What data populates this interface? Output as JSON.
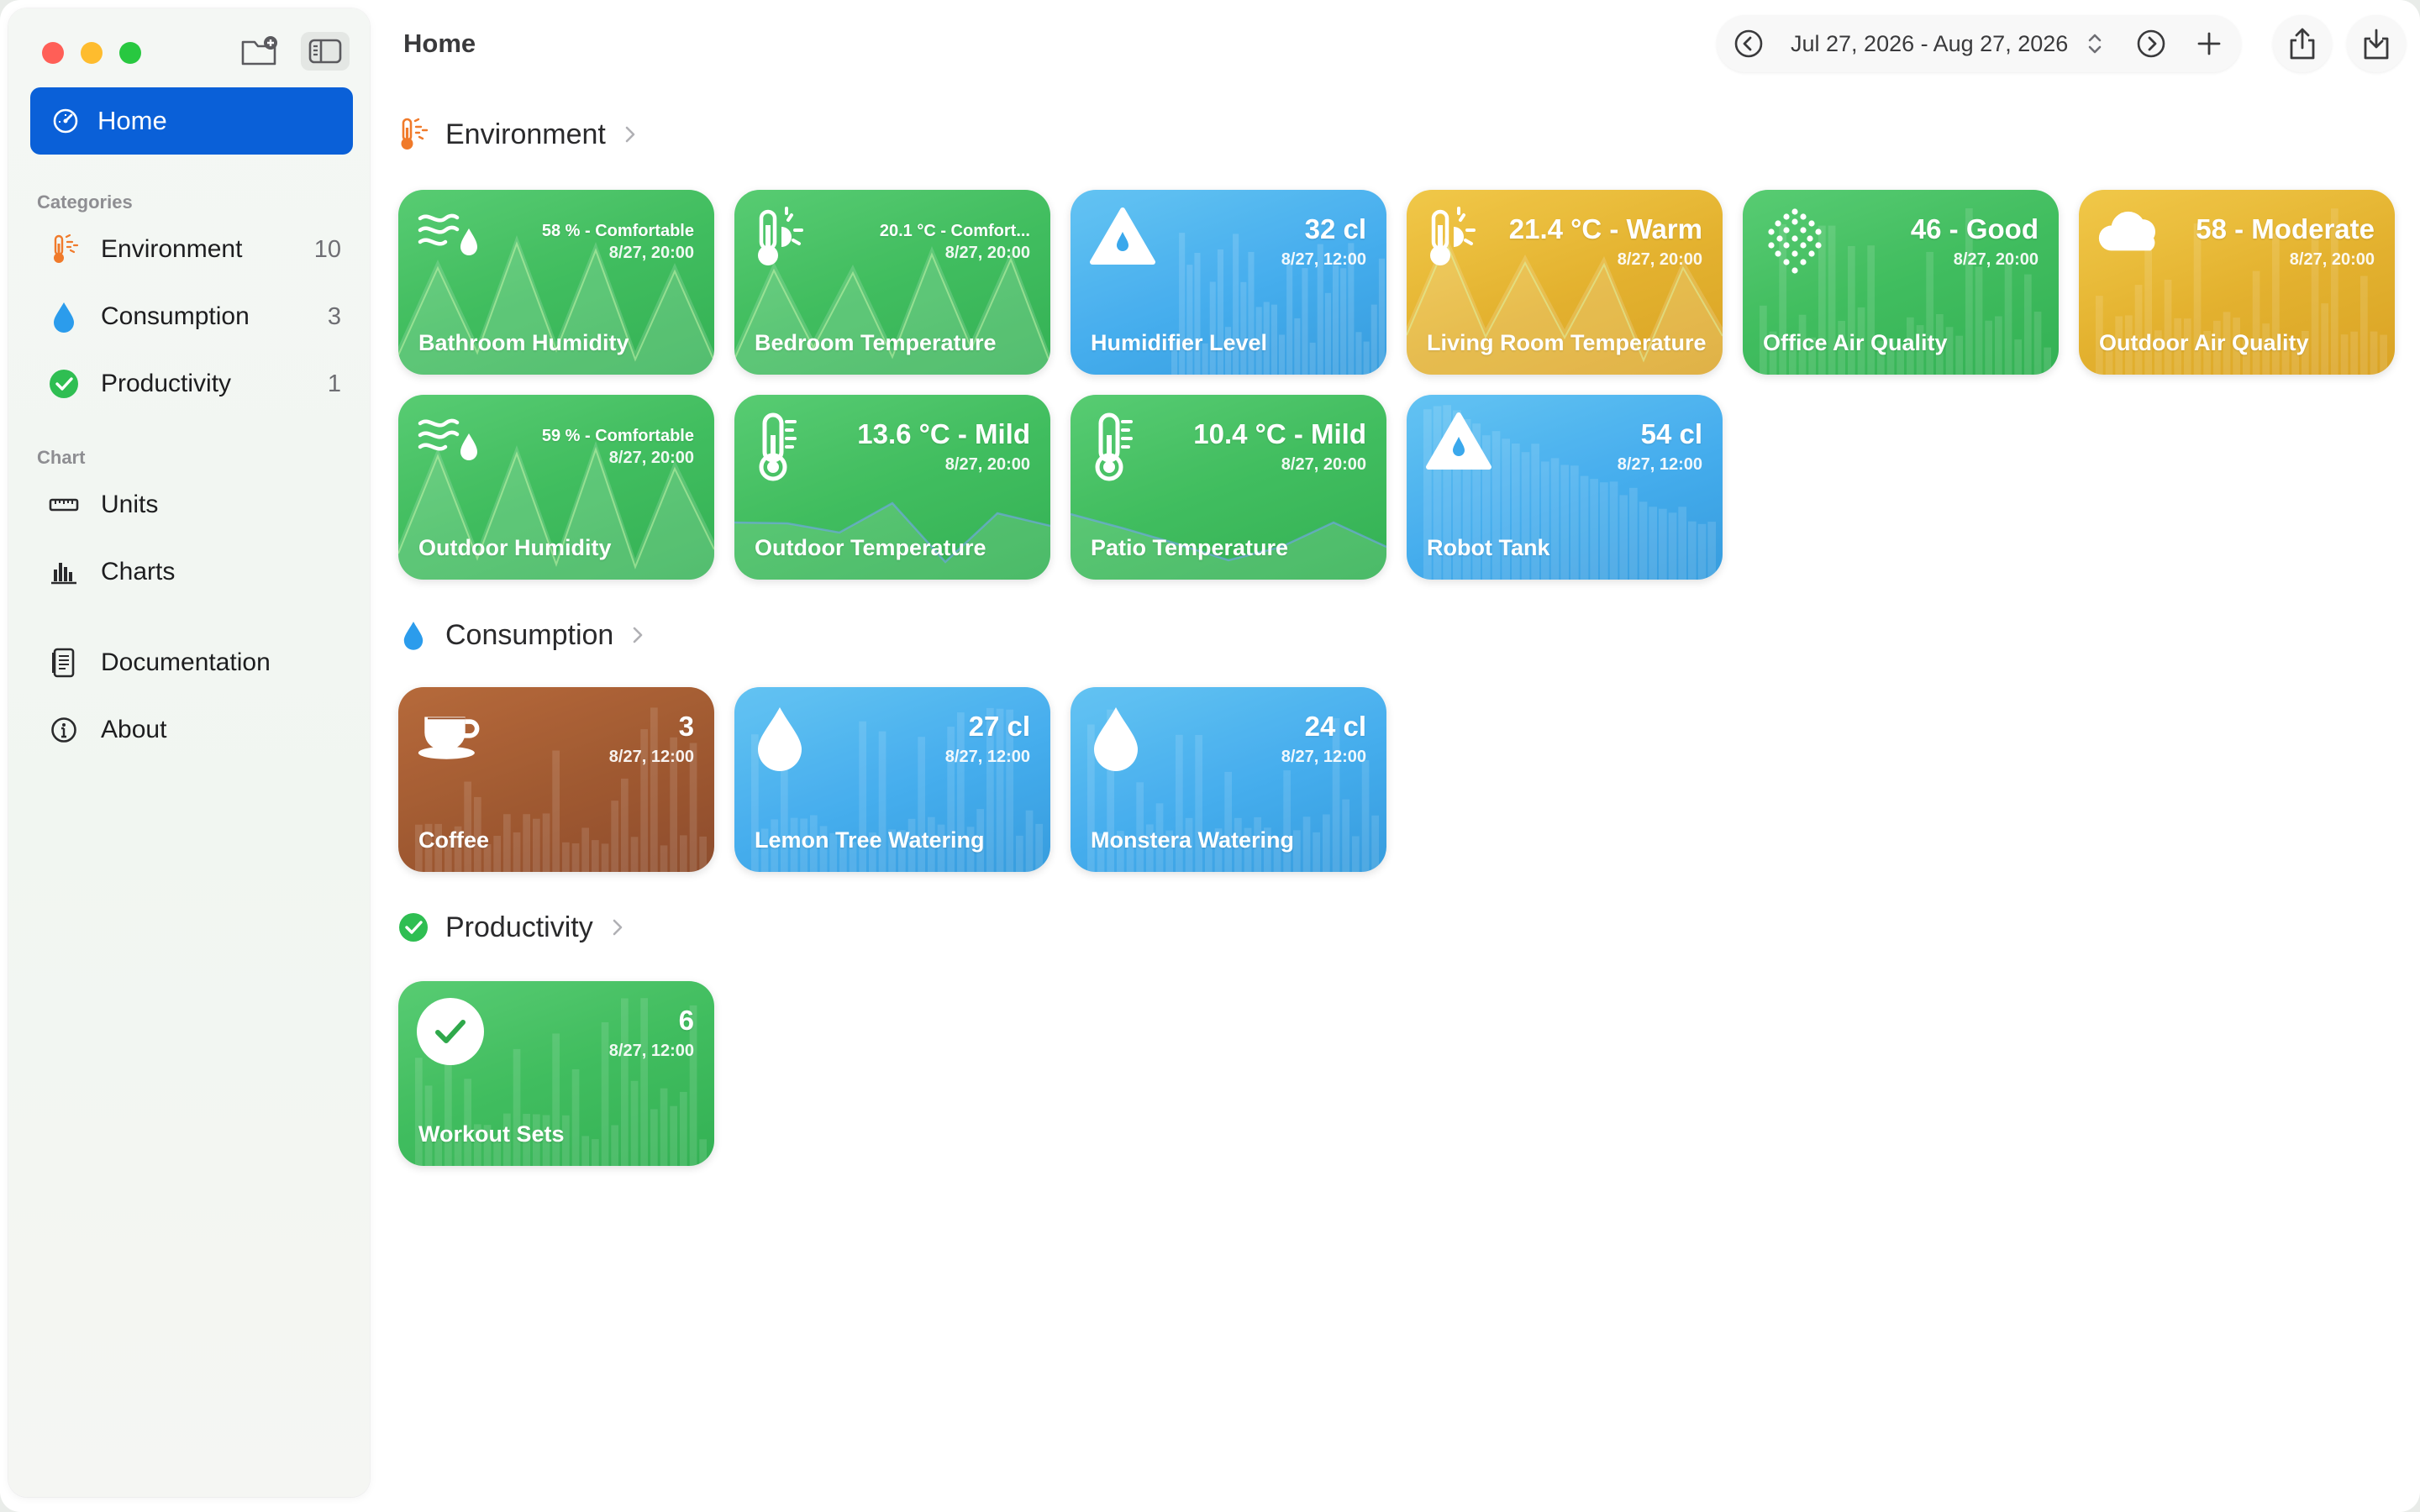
{
  "window": {
    "title": "Home"
  },
  "sidebar": {
    "home_label": "Home",
    "categories_header": "Categories",
    "categories": [
      {
        "label": "Environment",
        "count": "10",
        "icon": "thermometer-sun-icon"
      },
      {
        "label": "Consumption",
        "count": "3",
        "icon": "drop-icon"
      },
      {
        "label": "Productivity",
        "count": "1",
        "icon": "checkmark-circle-icon"
      }
    ],
    "chart_header": "Chart",
    "chart_items": [
      {
        "label": "Units",
        "icon": "ruler-icon"
      },
      {
        "label": "Charts",
        "icon": "bar-chart-icon"
      }
    ],
    "bottom_items": [
      {
        "label": "Documentation",
        "icon": "document-icon"
      },
      {
        "label": "About",
        "icon": "info-icon"
      }
    ]
  },
  "toolbar": {
    "date_range": "Jul 27, 2026 - Aug 27, 2026"
  },
  "sections": {
    "environment": {
      "title": "Environment",
      "cards": [
        {
          "name": "Bathroom Humidity",
          "value": "58 % - Comfortable",
          "time": "8/27, 20:00",
          "color": "green",
          "icon": "humidity-icon"
        },
        {
          "name": "Bedroom Temperature",
          "value": "20.1 °C - Comfort...",
          "time": "8/27, 20:00",
          "color": "green",
          "icon": "thermometer-sun-icon"
        },
        {
          "name": "Humidifier Level",
          "value": "32 cl",
          "time": "8/27, 12:00",
          "color": "blue",
          "icon": "triangle-drop-icon"
        },
        {
          "name": "Living Room Temperature",
          "value": "21.4 °C - Warm",
          "time": "8/27, 20:00",
          "color": "yellow",
          "icon": "thermometer-sun-icon"
        },
        {
          "name": "Office Air Quality",
          "value": "46  - Good",
          "time": "8/27, 20:00",
          "color": "green",
          "icon": "dots-icon"
        },
        {
          "name": "Outdoor Air Quality",
          "value": "58  - Moderate",
          "time": "8/27, 20:00",
          "color": "yellow",
          "icon": "cloud-icon"
        },
        {
          "name": "Outdoor Humidity",
          "value": "59 % - Comfortable",
          "time": "8/27, 20:00",
          "color": "green",
          "icon": "humidity-icon"
        },
        {
          "name": "Outdoor Temperature",
          "value": "13.6 °C - Mild",
          "time": "8/27, 20:00",
          "color": "green",
          "icon": "thermometer-icon"
        },
        {
          "name": "Patio Temperature",
          "value": "10.4 °C - Mild",
          "time": "8/27, 20:00",
          "color": "green",
          "icon": "thermometer-icon"
        },
        {
          "name": "Robot Tank",
          "value": "54 cl",
          "time": "8/27, 12:00",
          "color": "blue",
          "icon": "triangle-drop-icon"
        }
      ]
    },
    "consumption": {
      "title": "Consumption",
      "cards": [
        {
          "name": "Coffee",
          "value": "3",
          "time": "8/27, 12:00",
          "color": "brown",
          "icon": "coffee-cup-icon"
        },
        {
          "name": "Lemon Tree Watering",
          "value": "27 cl",
          "time": "8/27, 12:00",
          "color": "blue",
          "icon": "drop-icon"
        },
        {
          "name": "Monstera Watering",
          "value": "24 cl",
          "time": "8/27, 12:00",
          "color": "blue",
          "icon": "drop-icon"
        }
      ]
    },
    "productivity": {
      "title": "Productivity",
      "cards": [
        {
          "name": "Workout Sets",
          "value": "6",
          "time": "8/27, 12:00",
          "color": "green",
          "icon": "checkmark-circle-icon"
        }
      ]
    }
  },
  "colors": {
    "accent": "#0a60d8",
    "green": "#35b955",
    "blue": "#3aa8ec",
    "yellow": "#e2ad22",
    "brown": "#9a4f25"
  }
}
